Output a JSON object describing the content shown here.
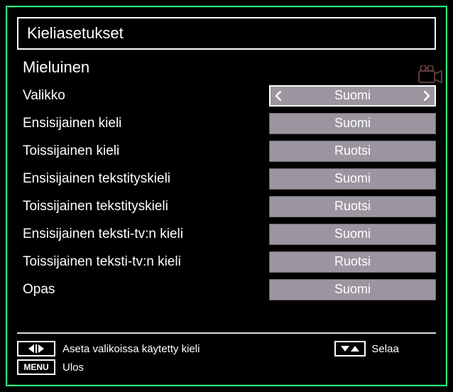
{
  "title": "Kieliasetukset",
  "section": "Mieluinen",
  "rows": [
    {
      "label": "Valikko",
      "value": "Suomi",
      "selected": true
    },
    {
      "label": "Ensisijainen kieli",
      "value": "Suomi",
      "selected": false
    },
    {
      "label": "Toissijainen kieli",
      "value": "Ruotsi",
      "selected": false
    },
    {
      "label": "Ensisijainen tekstityskieli",
      "value": "Suomi",
      "selected": false
    },
    {
      "label": "Toissijainen tekstityskieli",
      "value": "Ruotsi",
      "selected": false
    },
    {
      "label": "Ensisijainen teksti-tv:n kieli",
      "value": "Suomi",
      "selected": false
    },
    {
      "label": "Toissijainen teksti-tv:n kieli",
      "value": "Ruotsi",
      "selected": false
    },
    {
      "label": "Opas",
      "value": "Suomi",
      "selected": false
    }
  ],
  "footer": {
    "hint1": "Aseta valikoissa käytetty kieli",
    "hint2": "Selaa",
    "menu_key": "MENU",
    "menu_action": "Ulos"
  }
}
